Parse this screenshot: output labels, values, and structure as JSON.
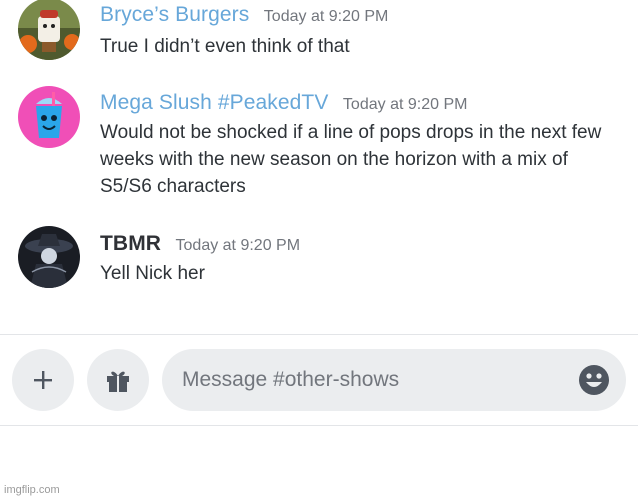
{
  "messages": [
    {
      "username": "Bryce’s Burgers",
      "timestamp": "Today at 9:20 PM",
      "text": "True I didn’t even think of that",
      "name_color": "#67a7d9",
      "avatar": "burger-character-avatar"
    },
    {
      "username": "Mega Slush #PeakedTV",
      "timestamp": "Today at 9:20 PM",
      "text": "Would not be shocked if a line of pops drops in the next few weeks with the new season on the horizon with a mix of S5/S6 characters",
      "name_color": "#67a7d9",
      "avatar": "blue-slush-cup-avatar"
    },
    {
      "username": "TBMR",
      "timestamp": "Today at 9:20 PM",
      "text": "Yell Nick her",
      "name_color": "#2f3136",
      "avatar": "dark-hat-figure-avatar"
    }
  ],
  "composer": {
    "placeholder": "Message #other-shows",
    "add_icon": "plus-icon",
    "gift_icon": "gift-icon",
    "emoji_icon": "emoji-smile-icon"
  },
  "watermark": "imgflip.com",
  "colors": {
    "background": "#ffffff",
    "input_background": "#ebedef",
    "link_name": "#67a7d9",
    "timestamp": "#72767d"
  }
}
